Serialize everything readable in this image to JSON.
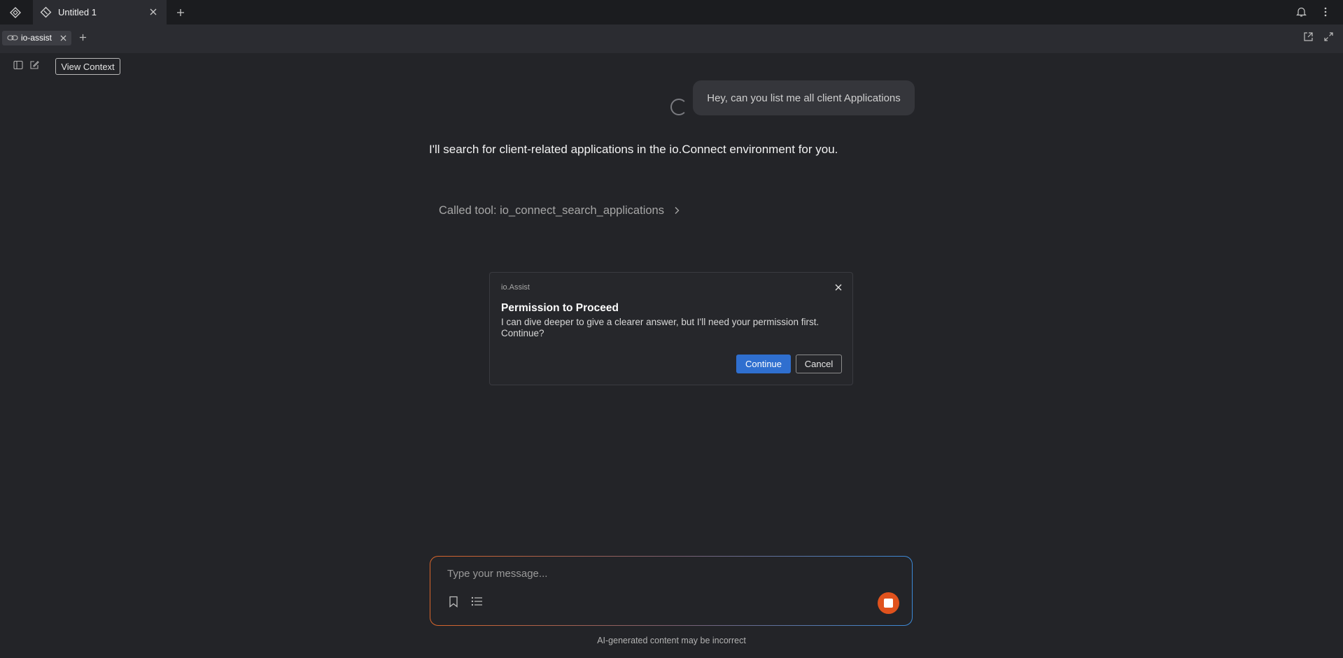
{
  "window": {
    "tab_title": "Untitled 1"
  },
  "app_tabs": {
    "active_label": "io-assist"
  },
  "toolbar": {
    "view_context_label": "View Context"
  },
  "conversation": {
    "user_message": "Hey, can you list me all client Applications",
    "assistant_message": "I'll search for client-related applications in the io.Connect environment for you.",
    "tool_call_label": "Called tool: io_connect_search_applications"
  },
  "dialog": {
    "source": "io.Assist",
    "title": "Permission to Proceed",
    "body": "I can dive deeper to give a clearer answer, but I'll need your permission first. Continue?",
    "continue_label": "Continue",
    "cancel_label": "Cancel"
  },
  "composer": {
    "placeholder": "Type your message...",
    "disclaimer": "AI-generated content may be incorrect"
  },
  "colors": {
    "background": "#232428",
    "accent_blue": "#2f6fcf",
    "stop_orange": "#e0521d"
  },
  "icons": [
    "app-logo-icon",
    "tab-icon",
    "close-icon",
    "plus-icon",
    "bell-icon",
    "kebab-icon",
    "chain-link-icon",
    "popout-icon",
    "expand-icon",
    "sidebar-icon",
    "edit-icon",
    "chevron-right-icon",
    "bookmark-icon",
    "list-icon",
    "stop-icon"
  ]
}
